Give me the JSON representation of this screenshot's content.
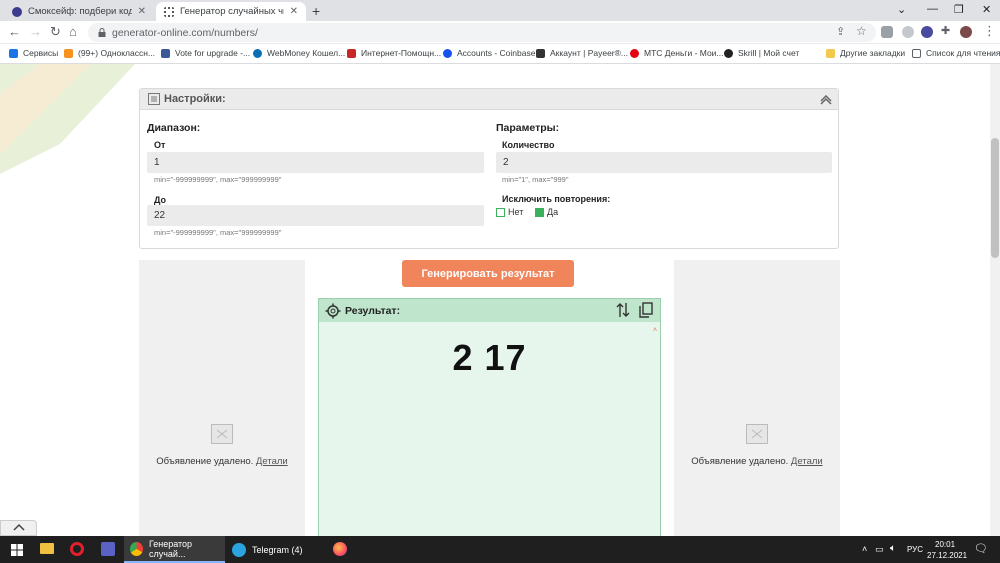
{
  "browser": {
    "tabs": [
      {
        "title": "Смоксейф: подбери код и полу",
        "active": false
      },
      {
        "title": "Генератор случайных чисел он",
        "active": true
      }
    ],
    "url": "generator-online.com/numbers/",
    "bookmarks": [
      "Сервисы",
      "(99+) Одноклассн...",
      "Vote for upgrade -...",
      "WebMoney Кошел...",
      "Интернет-Помощн...",
      "Accounts - Coinbase",
      "Аккаунт | Payeer®...",
      "МТС Деньги - Мои...",
      "Skrill | Мой счет",
      "Другие закладки",
      "Список для чтения"
    ]
  },
  "settings": {
    "title": "Настройки:",
    "range": {
      "heading": "Диапазон:",
      "from_label": "От",
      "from_value": "1",
      "from_hint": "min=\"-999999999\", max=\"999999999\"",
      "to_label": "До",
      "to_value": "22",
      "to_hint": "min=\"-999999999\", max=\"999999999\""
    },
    "params": {
      "heading": "Параметры:",
      "count_label": "Количество",
      "count_value": "2",
      "count_hint": "min=\"1\", max=\"999\"",
      "exclude_label": "Исключить повторения:",
      "no_label": "Нет",
      "yes_label": "Да",
      "selected": "Да"
    }
  },
  "generate_button": "Генерировать результат",
  "result": {
    "title": "Результат:",
    "value": "2 17"
  },
  "ads": [
    {
      "text": "Объявление удалено.",
      "link": "Детали"
    },
    {
      "text": "Объявление удалено.",
      "link": "Детали"
    }
  ],
  "taskbar": {
    "apps": [
      {
        "label": "Генератор случай...",
        "active": true
      },
      {
        "label": "Telegram (4)",
        "active": false
      }
    ],
    "lang": "РУС",
    "time": "20:01",
    "date": "27.12.2021"
  },
  "colors": {
    "accent": "#f0845a",
    "result_header": "#bfe5cc",
    "result_bg": "#e7f6ec",
    "checkbox_on": "#3cb15d"
  }
}
